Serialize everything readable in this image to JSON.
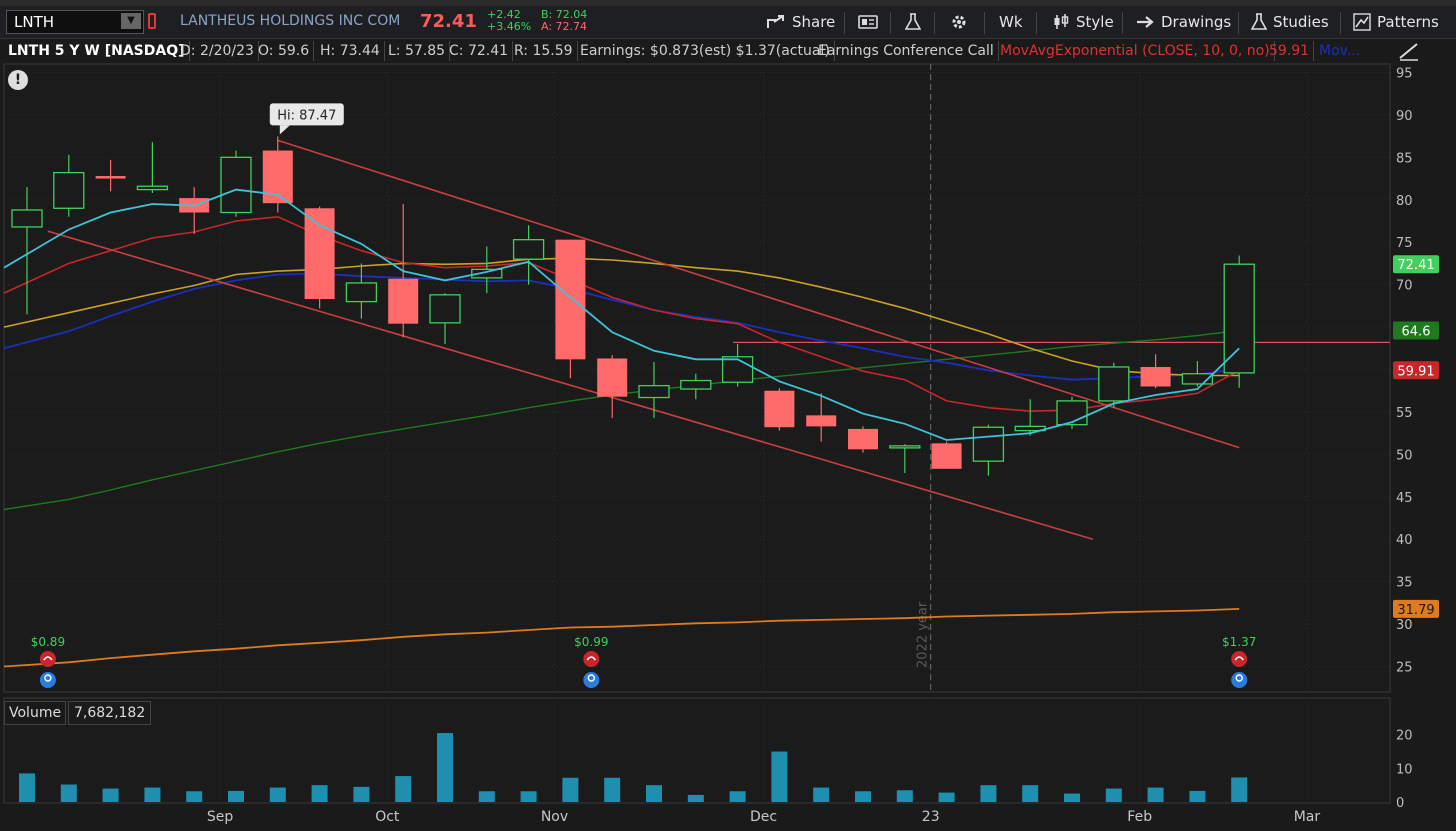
{
  "toolbar": {
    "symbol": "LNTH",
    "company": "LANTHEUS HOLDINGS INC COM",
    "last": "72.41",
    "net_change": "+2.42",
    "pct_change": "+3.46%",
    "bid": "B: 72.04",
    "ask": "A: 72.74",
    "share": "Share",
    "timeframe": "Wk",
    "style": "Style",
    "drawings": "Drawings",
    "studies": "Studies",
    "patterns": "Patterns"
  },
  "infobar": {
    "title": "LNTH 5 Y W [NASDAQ]",
    "date": "D: 2/20/23",
    "open": "O: 59.6",
    "high": "H: 73.44",
    "low": "L: 57.85",
    "close": "C: 72.41",
    "range": "R: 15.59",
    "earnings": "Earnings: $0.873(est) $1.37(actual)",
    "event": "Earnings Conference Call",
    "study": "MovAvgExponential (CLOSE, 10, 0, no)",
    "study_value": "59.91",
    "study2": "Mov..."
  },
  "colors": {
    "up": "#3fd15b",
    "down": "#ff6b6b",
    "ema_cyan": "#3ec3d6",
    "ema_red": "#c8262a",
    "ema_yellow": "#c9a227",
    "ema_navy": "#1a2fbf",
    "sma_green": "#1f7a1f",
    "sma_orange": "#e07a1f",
    "channel": "#c84040",
    "volume": "#1f8fb0"
  },
  "chart_data": {
    "type": "candlestick",
    "price_axis": {
      "min": 22,
      "max": 96,
      "ticks": [
        25,
        30,
        35,
        40,
        45,
        50,
        55,
        60,
        65,
        70,
        75,
        80,
        85,
        90,
        95
      ]
    },
    "x_labels": [
      "Sep",
      "Oct",
      "Nov",
      "Dec",
      "23",
      "Feb",
      "Mar"
    ],
    "separator_label": "2022 year",
    "high_annotation": "Hi: 87.47",
    "candles": [
      {
        "o": 76.8,
        "h": 81.5,
        "l": 66.5,
        "c": 78.8
      },
      {
        "o": 79.0,
        "h": 85.3,
        "l": 78.0,
        "c": 83.2
      },
      {
        "o": 82.8,
        "h": 84.7,
        "l": 81.0,
        "c": 82.5
      },
      {
        "o": 81.2,
        "h": 86.8,
        "l": 80.8,
        "c": 81.6
      },
      {
        "o": 80.2,
        "h": 81.5,
        "l": 76.0,
        "c": 78.5
      },
      {
        "o": 78.5,
        "h": 85.8,
        "l": 78.0,
        "c": 85.0
      },
      {
        "o": 85.8,
        "h": 87.47,
        "l": 78.5,
        "c": 79.6
      },
      {
        "o": 79.0,
        "h": 79.2,
        "l": 67.2,
        "c": 68.3
      },
      {
        "o": 68.0,
        "h": 72.5,
        "l": 66.0,
        "c": 70.2
      },
      {
        "o": 70.7,
        "h": 79.5,
        "l": 63.8,
        "c": 65.4
      },
      {
        "o": 65.5,
        "h": 69.0,
        "l": 63.0,
        "c": 68.8
      },
      {
        "o": 70.8,
        "h": 74.5,
        "l": 69.0,
        "c": 71.8
      },
      {
        "o": 73.0,
        "h": 77.0,
        "l": 70.0,
        "c": 75.3
      },
      {
        "o": 75.3,
        "h": 75.3,
        "l": 59.0,
        "c": 61.2
      },
      {
        "o": 61.3,
        "h": 61.7,
        "l": 54.3,
        "c": 56.8
      },
      {
        "o": 56.7,
        "h": 60.9,
        "l": 54.3,
        "c": 58.1
      },
      {
        "o": 57.7,
        "h": 59.5,
        "l": 56.5,
        "c": 58.7
      },
      {
        "o": 58.5,
        "h": 63.0,
        "l": 58.0,
        "c": 61.5
      },
      {
        "o": 57.5,
        "h": 57.8,
        "l": 52.8,
        "c": 53.2
      },
      {
        "o": 54.6,
        "h": 57.2,
        "l": 51.5,
        "c": 53.3
      },
      {
        "o": 53.0,
        "h": 53.3,
        "l": 50.2,
        "c": 50.6
      },
      {
        "o": 50.8,
        "h": 51.2,
        "l": 47.8,
        "c": 51.0
      },
      {
        "o": 51.3,
        "h": 51.5,
        "l": 48.3,
        "c": 48.3
      },
      {
        "o": 49.2,
        "h": 53.5,
        "l": 47.5,
        "c": 53.2
      },
      {
        "o": 52.8,
        "h": 56.5,
        "l": 52.2,
        "c": 53.3
      },
      {
        "o": 53.5,
        "h": 56.8,
        "l": 53.0,
        "c": 56.3
      },
      {
        "o": 56.3,
        "h": 60.8,
        "l": 55.5,
        "c": 60.3
      },
      {
        "o": 60.3,
        "h": 61.8,
        "l": 57.8,
        "c": 58.0
      },
      {
        "o": 58.3,
        "h": 61.0,
        "l": 58.0,
        "c": 59.5
      },
      {
        "o": 59.6,
        "h": 73.44,
        "l": 57.85,
        "c": 72.41
      }
    ],
    "lines": {
      "ema_cyan": [
        72,
        76.5,
        78.5,
        79.5,
        79.3,
        81.2,
        80.6,
        77.0,
        74.8,
        71.6,
        70.5,
        71.5,
        72.7,
        68.5,
        64.4,
        62.2,
        61.2,
        61.2,
        58.6,
        56.9,
        54.8,
        53.6,
        51.7,
        52.1,
        52.5,
        53.8,
        56.0,
        57.0,
        57.7,
        62.5
      ],
      "ema_red": [
        69,
        72.5,
        74.0,
        75.5,
        76.2,
        77.5,
        78.0,
        75.8,
        74.0,
        72.6,
        72.0,
        72.2,
        72.6,
        70.6,
        68.5,
        67.0,
        66.0,
        65.4,
        63.2,
        61.5,
        59.8,
        58.8,
        56.3,
        55.5,
        55.1,
        55.2,
        56.0,
        56.5,
        57.2,
        59.91
      ],
      "ema_yellow": [
        65,
        66.7,
        67.8,
        68.9,
        69.9,
        71.2,
        71.6,
        71.8,
        72.2,
        72.5,
        72.4,
        72.5,
        73.0,
        73.1,
        72.9,
        72.5,
        72.0,
        71.6,
        70.8,
        69.7,
        68.5,
        67.2,
        65.7,
        64.2,
        62.5,
        61.0,
        59.9,
        59.5,
        59.3,
        59.3
      ],
      "ema_navy": [
        62.5,
        64.5,
        66.3,
        68.0,
        69.5,
        70.5,
        71.2,
        71.3,
        71.0,
        70.8,
        70.6,
        70.4,
        70.5,
        69.5,
        68.2,
        67.0,
        66.2,
        65.5,
        64.4,
        63.4,
        62.5,
        61.5,
        60.8,
        59.9,
        59.3,
        58.8,
        59.0,
        59.2,
        59.4,
        60.1
      ],
      "sma_green": [
        43.5,
        44.7,
        45.8,
        47.0,
        48.1,
        49.2,
        50.3,
        51.3,
        52.2,
        53.0,
        53.8,
        54.6,
        55.5,
        56.3,
        57.0,
        57.6,
        58.1,
        58.7,
        59.2,
        59.7,
        60.2,
        60.7,
        61.2,
        61.7,
        62.2,
        62.7,
        63.1,
        63.5,
        64.0,
        64.6
      ],
      "sma_orange": [
        25.0,
        25.5,
        26.0,
        26.4,
        26.8,
        27.1,
        27.5,
        27.8,
        28.1,
        28.5,
        28.8,
        29.0,
        29.3,
        29.6,
        29.7,
        29.9,
        30.1,
        30.2,
        30.4,
        30.5,
        30.6,
        30.7,
        30.9,
        31.0,
        31.1,
        31.2,
        31.4,
        31.5,
        31.6,
        31.79
      ]
    },
    "channel": [
      {
        "from": {
          "i": 6,
          "p": 87.0
        },
        "to": {
          "i": 29,
          "p": 50.8
        }
      },
      {
        "from": {
          "i": 0.5,
          "p": 76.3
        },
        "to": {
          "i": 25.5,
          "p": 40.0
        }
      }
    ],
    "horizontal_line": 63.2,
    "earnings": [
      {
        "i": 0.5,
        "label": "$0.89"
      },
      {
        "i": 13.5,
        "label": "$0.99"
      },
      {
        "i": 29,
        "label": "$1.37"
      }
    ],
    "price_tags": [
      {
        "value": 72.41,
        "label": "72.41",
        "color": "#3fd15b",
        "text": "#ffffff"
      },
      {
        "value": 64.6,
        "label": "64.6",
        "color": "#1f7a1f",
        "text": "#ffffff"
      },
      {
        "value": 59.91,
        "label": "59.91",
        "color": "#c8262a",
        "text": "#ffffff"
      },
      {
        "value": 31.79,
        "label": "31.79",
        "color": "#e07a1f",
        "text": "#1a1a1a"
      }
    ],
    "volume": {
      "label": "Volume",
      "value": "7,682,182",
      "axis_ticks": [
        0,
        10,
        20
      ],
      "max": 22,
      "values": [
        8.5,
        5.2,
        4.0,
        4.3,
        3.2,
        3.3,
        4.3,
        5.0,
        4.5,
        7.7,
        20.5,
        3.2,
        3.2,
        7.2,
        7.2,
        5.0,
        2.1,
        3.2,
        15.0,
        4.3,
        3.2,
        3.5,
        2.8,
        5.0,
        5.0,
        2.5,
        4.0,
        4.3,
        3.3,
        7.3
      ]
    }
  }
}
